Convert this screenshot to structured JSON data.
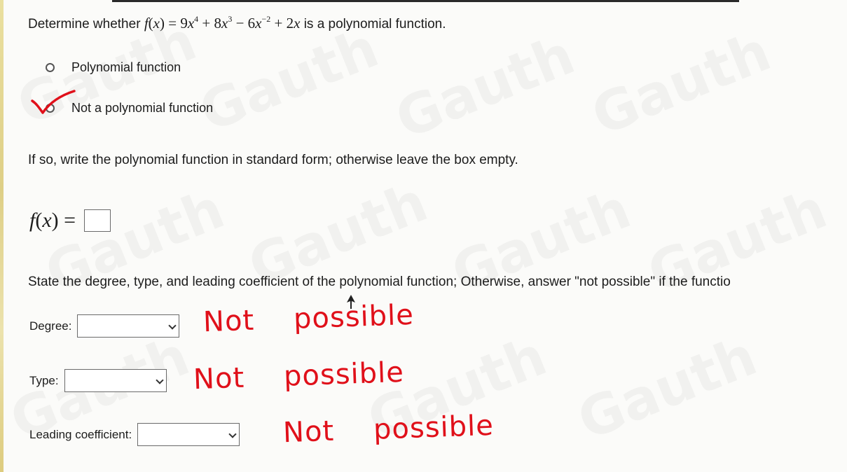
{
  "question": {
    "prefix": "Determine whether",
    "function_name": "f",
    "variable": "x",
    "equals": "=",
    "terms": {
      "t1_coef": "9",
      "t1_exp": "4",
      "t2_coef": "8",
      "t2_exp": "3",
      "t3_coef": "6",
      "t3_exp": "−2",
      "t4_coef": "2"
    },
    "suffix": "is a polynomial function."
  },
  "options": [
    {
      "label": "Polynomial function",
      "selected": false
    },
    {
      "label": "Not a polynomial function",
      "selected": true
    }
  ],
  "instruction_standard_form": "If so, write the polynomial function in standard form; otherwise leave the box empty.",
  "fx_answer": {
    "function_name": "f",
    "variable": "x",
    "equals": "=",
    "value": ""
  },
  "instruction_degree": "State the degree, type, and leading coefficient of the polynomial function; Otherwise, answer \"not possible\" if the functio",
  "fields": {
    "degree": {
      "label": "Degree:",
      "value": ""
    },
    "type": {
      "label": "Type:",
      "value": ""
    },
    "leading": {
      "label": "Leading coefficient:",
      "value": ""
    }
  },
  "annotations": {
    "word1": "Not",
    "word2": "possible",
    "color": "#e0101a"
  },
  "watermark": "Gauth",
  "colors": {
    "background": "#fbfbf9",
    "text": "#1c1c1c",
    "checkmark": "#e0101a"
  }
}
